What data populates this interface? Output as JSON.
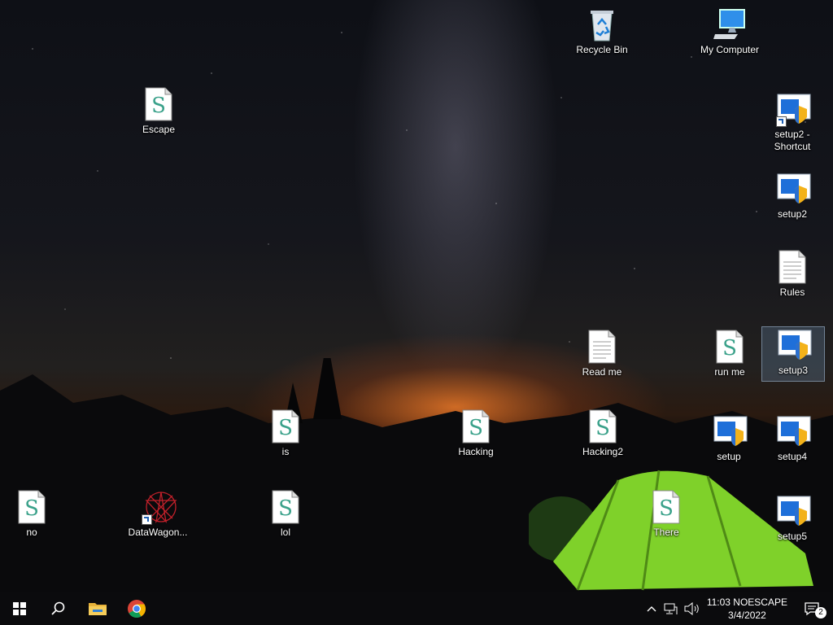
{
  "desktop": {
    "icons": [
      {
        "label": "Recycle Bin",
        "icon": "recycle-bin-icon"
      },
      {
        "label": "My Computer",
        "icon": "computer-icon"
      },
      {
        "label": "Escape",
        "icon": "script-icon"
      },
      {
        "label": "setup2 - Shortcut",
        "icon": "setup-shortcut-icon"
      },
      {
        "label": "setup2",
        "icon": "setup-icon"
      },
      {
        "label": "Rules",
        "icon": "text-file-icon"
      },
      {
        "label": "Read me",
        "icon": "text-file-icon"
      },
      {
        "label": "run me",
        "icon": "script-icon"
      },
      {
        "label": "setup3",
        "icon": "setup-icon",
        "selected": true
      },
      {
        "label": "is",
        "icon": "script-icon"
      },
      {
        "label": "Hacking",
        "icon": "script-icon"
      },
      {
        "label": "Hacking2",
        "icon": "script-icon"
      },
      {
        "label": "setup",
        "icon": "setup-icon"
      },
      {
        "label": "setup4",
        "icon": "setup-icon"
      },
      {
        "label": "no",
        "icon": "script-icon"
      },
      {
        "label": "DataWagon...",
        "icon": "datawagon-shortcut-icon"
      },
      {
        "label": "lol",
        "icon": "script-icon"
      },
      {
        "label": "There",
        "icon": "script-icon"
      },
      {
        "label": "setup5",
        "icon": "setup-icon"
      }
    ]
  },
  "taskbar": {
    "pinned": [
      "start-icon",
      "search-icon",
      "file-explorer-icon",
      "chrome-icon"
    ],
    "tray": {
      "time_user": "11:03 NOESCAPE",
      "date": "3/4/2022",
      "notification_count": "2"
    }
  },
  "colors": {
    "taskbar": "#0b0b0d",
    "accent": "#1e6fd9",
    "tent": "#7fd12a"
  }
}
